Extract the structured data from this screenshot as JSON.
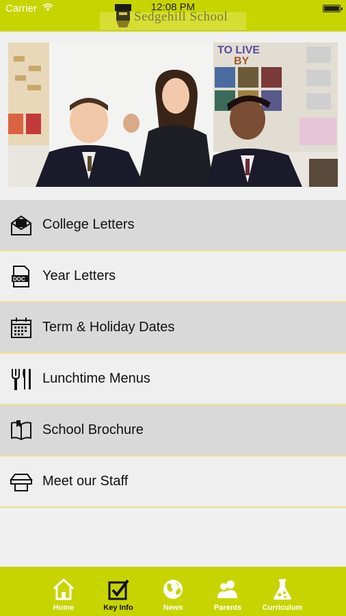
{
  "status_bar": {
    "carrier": "Carrier",
    "time": "12:08 PM"
  },
  "header": {
    "school_name": "Sedgehill School"
  },
  "hero": {
    "image_label": "classroom-photo"
  },
  "menu": {
    "items": [
      {
        "label": "College Letters",
        "icon": "envelope-icon"
      },
      {
        "label": "Year Letters",
        "icon": "doc-icon"
      },
      {
        "label": "Term & Holiday Dates",
        "icon": "calendar-icon"
      },
      {
        "label": "Lunchtime Menus",
        "icon": "cutlery-icon"
      },
      {
        "label": "School Brochure",
        "icon": "book-icon"
      },
      {
        "label": "Meet our Staff",
        "icon": "staff-icon"
      }
    ]
  },
  "tabbar": {
    "tabs": [
      {
        "label": "Home",
        "icon": "home-icon"
      },
      {
        "label": "Key Info",
        "icon": "checkbox-icon"
      },
      {
        "label": "News",
        "icon": "globe-icon"
      },
      {
        "label": "Parents",
        "icon": "parents-icon"
      },
      {
        "label": "Curriculum",
        "icon": "flask-icon"
      }
    ]
  },
  "colors": {
    "accent": "#c8d400",
    "divider": "#f2e08a",
    "row_shade": "#d9d9d9",
    "row_light": "#efefef"
  }
}
